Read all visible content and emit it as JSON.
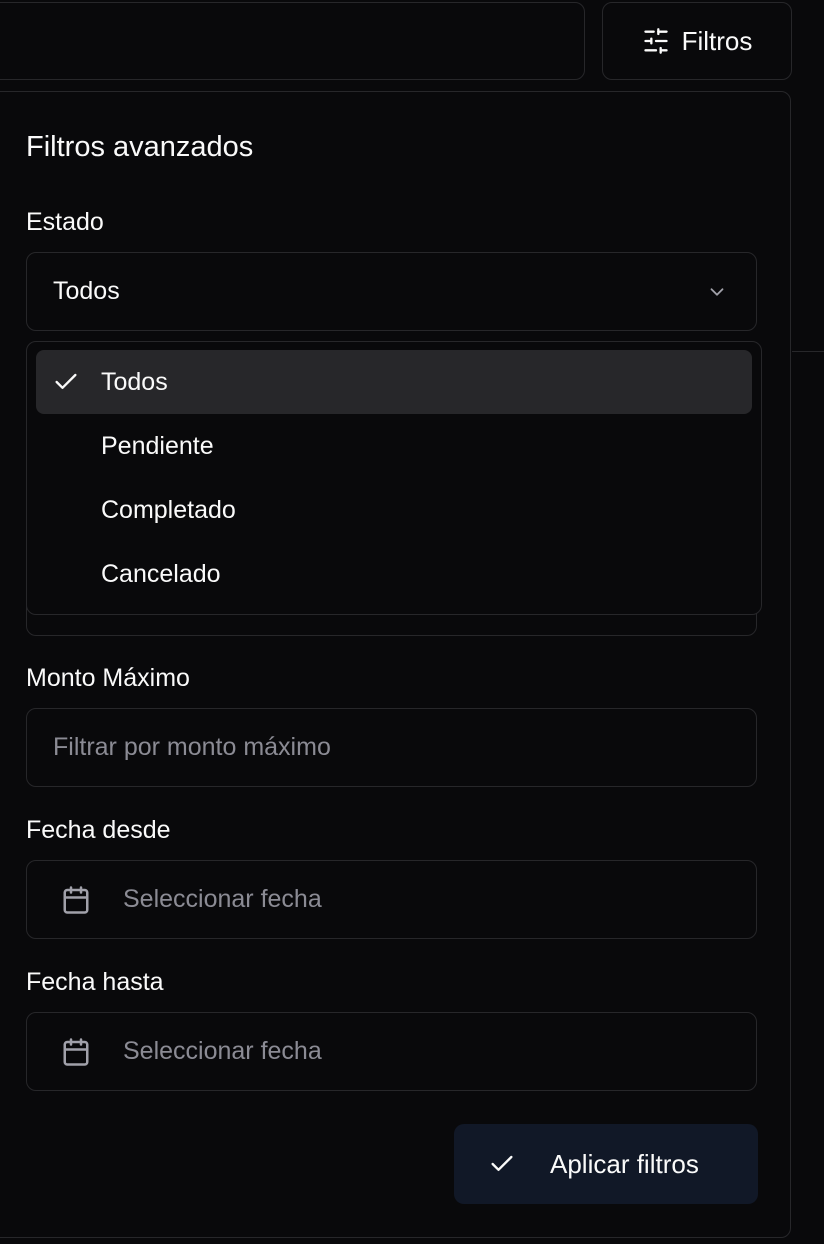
{
  "toolbar": {
    "filters_button": {
      "label": "Filtros",
      "icon": "sliders-horizontal-icon"
    }
  },
  "panel": {
    "title": "Filtros avanzados",
    "estado": {
      "label": "Estado",
      "selected": "Todos",
      "options": [
        "Todos",
        "Pendiente",
        "Completado",
        "Cancelado"
      ]
    },
    "monto_maximo": {
      "label": "Monto Máximo",
      "placeholder": "Filtrar por monto máximo"
    },
    "fecha_desde": {
      "label": "Fecha desde",
      "placeholder": "Seleccionar fecha",
      "icon": "calendar-icon"
    },
    "fecha_hasta": {
      "label": "Fecha hasta",
      "placeholder": "Seleccionar fecha",
      "icon": "calendar-icon"
    },
    "apply_button": {
      "label": "Aplicar filtros",
      "icon": "check-icon"
    }
  },
  "colors": {
    "background": "#09090b",
    "border": "#27272a",
    "text": "#fafafa",
    "muted": "#8b8b94",
    "selected_option": "#27272a",
    "apply_button": "#111827"
  }
}
